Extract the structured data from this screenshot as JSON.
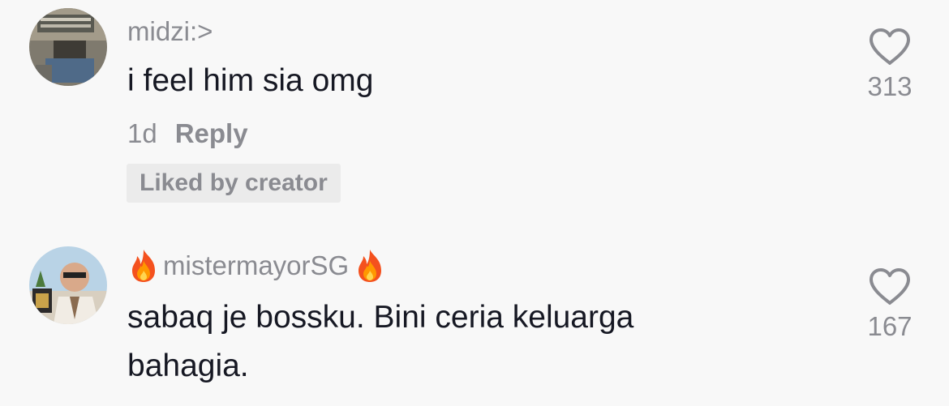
{
  "comments": [
    {
      "username": "midzi:>",
      "text": "i feel him sia omg",
      "age": "1d",
      "reply_label": "Reply",
      "badge": "Liked by creator",
      "like_count": "313",
      "avatar_icon": "user-avatar-photo"
    },
    {
      "username_prefix_icon": "fire-emoji-icon",
      "username": "mistermayorSG",
      "username_suffix_icon": "fire-emoji-icon",
      "text_line1": "sabaq je bossku. Bini ceria keluarga",
      "text_line2": "bahagia.",
      "like_count": "167",
      "avatar_icon": "user-avatar-photo"
    }
  ],
  "colors": {
    "background": "#f8f8f8",
    "primary_text": "#161823",
    "secondary_text": "#8a8b91",
    "badge_bg": "#ebebeb"
  }
}
